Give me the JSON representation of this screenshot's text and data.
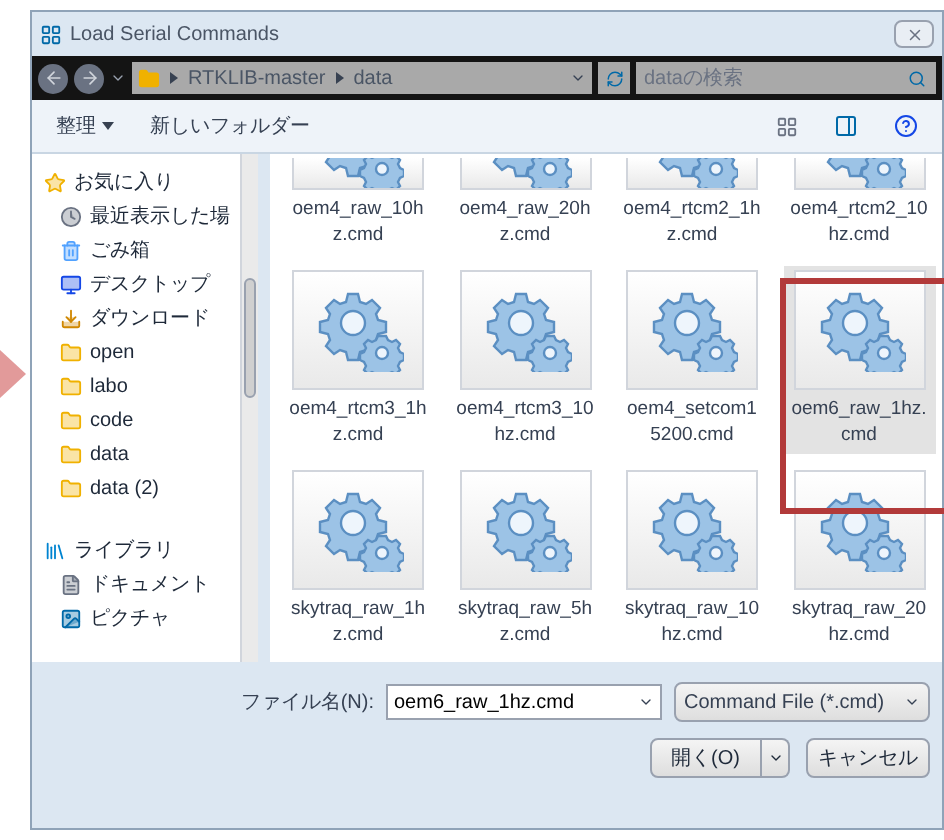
{
  "window": {
    "title": "Load Serial Commands"
  },
  "address_bar": {
    "path": [
      "RTKLIB-master",
      "data"
    ],
    "search_placeholder": "dataの検索"
  },
  "toolbar": {
    "organize": "整理",
    "new_folder": "新しいフォルダー"
  },
  "sidebar": {
    "groups": [
      {
        "kind": "favorites",
        "label": "お気に入り",
        "items": [
          {
            "kind": "recent",
            "label": "最近表示した場"
          },
          {
            "kind": "trash",
            "label": "ごみ箱"
          },
          {
            "kind": "desktop",
            "label": "デスクトップ"
          },
          {
            "kind": "download",
            "label": "ダウンロード"
          },
          {
            "kind": "folder",
            "label": "open"
          },
          {
            "kind": "folder",
            "label": "labo"
          },
          {
            "kind": "folder",
            "label": "code"
          },
          {
            "kind": "folder",
            "label": "data"
          },
          {
            "kind": "folder",
            "label": "data (2)"
          }
        ]
      },
      {
        "kind": "library",
        "label": "ライブラリ",
        "items": [
          {
            "kind": "document",
            "label": "ドキュメント"
          },
          {
            "kind": "picture",
            "label": "ピクチャ"
          }
        ]
      }
    ]
  },
  "files": [
    {
      "name": "oem4_raw_10hz.cmd",
      "selected": false,
      "clipped": true
    },
    {
      "name": "oem4_raw_20hz.cmd",
      "selected": false,
      "clipped": true
    },
    {
      "name": "oem4_rtcm2_1hz.cmd",
      "selected": false,
      "clipped": true
    },
    {
      "name": "oem4_rtcm2_10hz.cmd",
      "selected": false,
      "clipped": true
    },
    {
      "name": "oem4_rtcm3_1hz.cmd",
      "selected": false,
      "clipped": false
    },
    {
      "name": "oem4_rtcm3_10hz.cmd",
      "selected": false,
      "clipped": false
    },
    {
      "name": "oem4_setcom15200.cmd",
      "selected": false,
      "clipped": false
    },
    {
      "name": "oem6_raw_1hz.cmd",
      "selected": true,
      "clipped": false
    },
    {
      "name": "skytraq_raw_1hz.cmd",
      "selected": false,
      "clipped": false
    },
    {
      "name": "skytraq_raw_5hz.cmd",
      "selected": false,
      "clipped": false
    },
    {
      "name": "skytraq_raw_10hz.cmd",
      "selected": false,
      "clipped": false
    },
    {
      "name": "skytraq_raw_20hz.cmd",
      "selected": false,
      "clipped": false
    }
  ],
  "footer": {
    "filename_label": "ファイル名(N):",
    "filename_value": "oem6_raw_1hz.cmd",
    "filetype": "Command File (*.cmd)",
    "open_button": "開く(O)",
    "cancel_button": "キャンセル"
  }
}
